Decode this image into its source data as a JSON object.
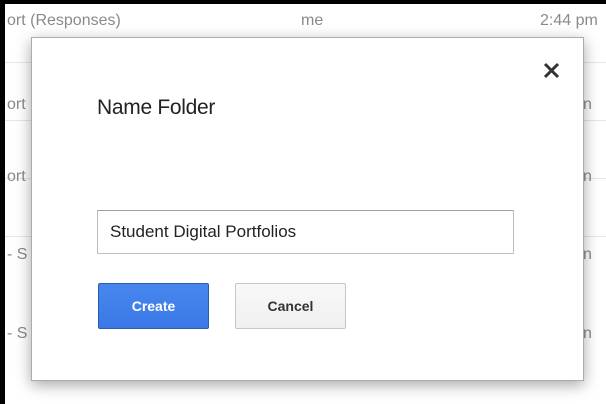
{
  "background_list": {
    "rows": [
      {
        "name": "ort (Responses)",
        "owner": "me",
        "time": "2:44 pm"
      },
      {
        "name": "ort",
        "owner": "",
        "time": "n"
      },
      {
        "name": "ort",
        "owner": "",
        "time": "n"
      },
      {
        "name": "- S",
        "owner": "",
        "time": "n"
      },
      {
        "name": "- S",
        "owner": "",
        "time": "n"
      }
    ]
  },
  "dialog": {
    "title": "Name Folder",
    "close_icon": "close-icon",
    "input_value": "Student Digital Portfolios",
    "create_label": "Create",
    "cancel_label": "Cancel"
  },
  "colors": {
    "primary_button": "#3b78e7",
    "secondary_button": "#f5f5f5",
    "muted_text": "#8a8a8a"
  }
}
